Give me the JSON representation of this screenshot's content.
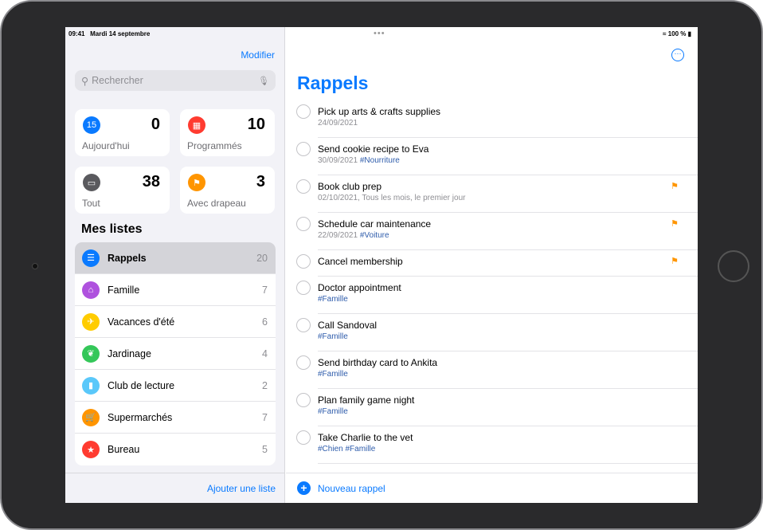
{
  "status": {
    "time": "09:41",
    "date": "Mardi 14 septembre",
    "battery": "100 %"
  },
  "sidebar": {
    "edit_label": "Modifier",
    "search_placeholder": "Rechercher",
    "smart": [
      {
        "label": "Aujourd'hui",
        "count": "0",
        "color": "#0a7aff",
        "icon": "calendar-today-icon"
      },
      {
        "label": "Programmés",
        "count": "10",
        "color": "#ff3b30",
        "icon": "calendar-icon"
      },
      {
        "label": "Tout",
        "count": "38",
        "color": "#5a5a5e",
        "icon": "tray-icon"
      },
      {
        "label": "Avec drapeau",
        "count": "3",
        "color": "#ff9500",
        "icon": "flag-icon"
      }
    ],
    "my_lists_title": "Mes listes",
    "lists": [
      {
        "label": "Rappels",
        "count": "20",
        "color": "#0a7aff",
        "icon": "list-icon",
        "selected": true
      },
      {
        "label": "Famille",
        "count": "7",
        "color": "#af52de",
        "icon": "house-icon"
      },
      {
        "label": "Vacances d'été",
        "count": "6",
        "color": "#ffcc00",
        "icon": "airplane-icon"
      },
      {
        "label": "Jardinage",
        "count": "4",
        "color": "#34c759",
        "icon": "leaf-icon"
      },
      {
        "label": "Club de lecture",
        "count": "2",
        "color": "#5ac8fa",
        "icon": "bookmark-icon"
      },
      {
        "label": "Supermarchés",
        "count": "7",
        "color": "#ff9500",
        "icon": "cart-icon"
      },
      {
        "label": "Bureau",
        "count": "5",
        "color": "#ff3b30",
        "icon": "star-icon"
      }
    ],
    "add_list_label": "Ajouter une liste"
  },
  "main": {
    "title": "Rappels",
    "new_reminder_label": "Nouveau rappel",
    "items": [
      {
        "title": "Pick up arts & crafts supplies",
        "date": "24/09/2021",
        "tags": "",
        "flag": false
      },
      {
        "title": "Send cookie recipe to Eva",
        "date": "30/09/2021",
        "tags": "#Nourriture",
        "flag": false
      },
      {
        "title": "Book club prep",
        "date": "02/10/2021, Tous les mois, le premier jour",
        "tags": "",
        "flag": true
      },
      {
        "title": "Schedule car maintenance",
        "date": "22/09/2021",
        "tags": "#Voiture",
        "flag": true
      },
      {
        "title": "Cancel membership",
        "date": "",
        "tags": "",
        "flag": true
      },
      {
        "title": "Doctor appointment",
        "date": "",
        "tags": "#Famille",
        "flag": false
      },
      {
        "title": "Call Sandoval",
        "date": "",
        "tags": "#Famille",
        "flag": false
      },
      {
        "title": "Send birthday card to Ankita",
        "date": "",
        "tags": "#Famille",
        "flag": false
      },
      {
        "title": "Plan family game night",
        "date": "",
        "tags": "#Famille",
        "flag": false
      },
      {
        "title": "Take Charlie to the vet",
        "date": "",
        "tags": "#Chien #Famille",
        "flag": false
      }
    ]
  }
}
